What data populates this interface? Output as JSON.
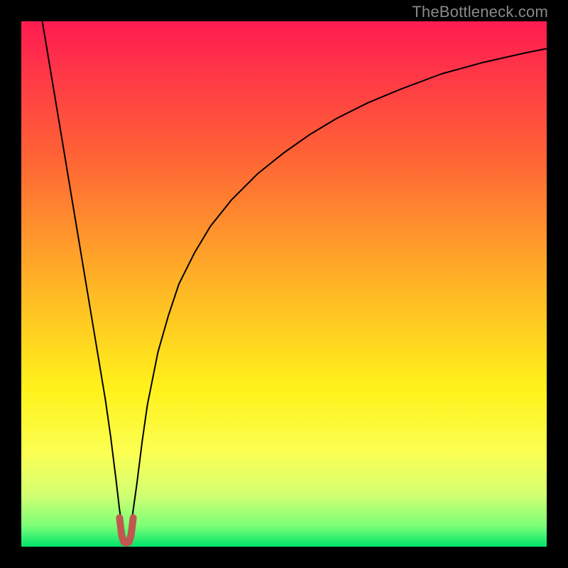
{
  "watermark": "TheBottleneck.com",
  "chart_data": {
    "type": "line",
    "title": "",
    "xlabel": "",
    "ylabel": "",
    "xlim": [
      0,
      100
    ],
    "ylim": [
      0,
      100
    ],
    "grid": false,
    "background_gradient": {
      "stops": [
        {
          "offset": 0,
          "color": "#ff1b52"
        },
        {
          "offset": 25,
          "color": "#ff6136"
        },
        {
          "offset": 50,
          "color": "#ffb426"
        },
        {
          "offset": 70,
          "color": "#fff21a"
        },
        {
          "offset": 82,
          "color": "#fcff52"
        },
        {
          "offset": 90,
          "color": "#d3ff72"
        },
        {
          "offset": 96,
          "color": "#7dff78"
        },
        {
          "offset": 100,
          "color": "#00e36b"
        }
      ]
    },
    "series": [
      {
        "name": "bottleneck-curve",
        "color": "#000000",
        "width": 2,
        "x": [
          4,
          6,
          8,
          10,
          12,
          14,
          15,
          16,
          17,
          18,
          18.7,
          19.3,
          20,
          20.7,
          21.3,
          22,
          23,
          24,
          26,
          28,
          30,
          33,
          36,
          40,
          45,
          50,
          55,
          60,
          66,
          72,
          80,
          88,
          96,
          100
        ],
        "y": [
          100,
          88,
          76,
          64,
          52,
          40,
          34,
          28,
          21,
          13,
          7,
          3,
          1,
          3,
          7,
          12,
          20,
          27,
          37,
          44,
          50,
          56,
          61,
          66,
          71,
          75,
          78.5,
          81.5,
          84.5,
          87,
          90,
          92.2,
          94,
          94.8
        ]
      },
      {
        "name": "minimum-marker",
        "color": "#c1584f",
        "width": 10,
        "linecap": "round",
        "x": [
          18.7,
          19.1,
          19.5,
          20,
          20.5,
          20.9,
          21.3
        ],
        "y": [
          5.5,
          2.2,
          0.9,
          0.7,
          0.9,
          2.2,
          5.5
        ]
      }
    ]
  }
}
